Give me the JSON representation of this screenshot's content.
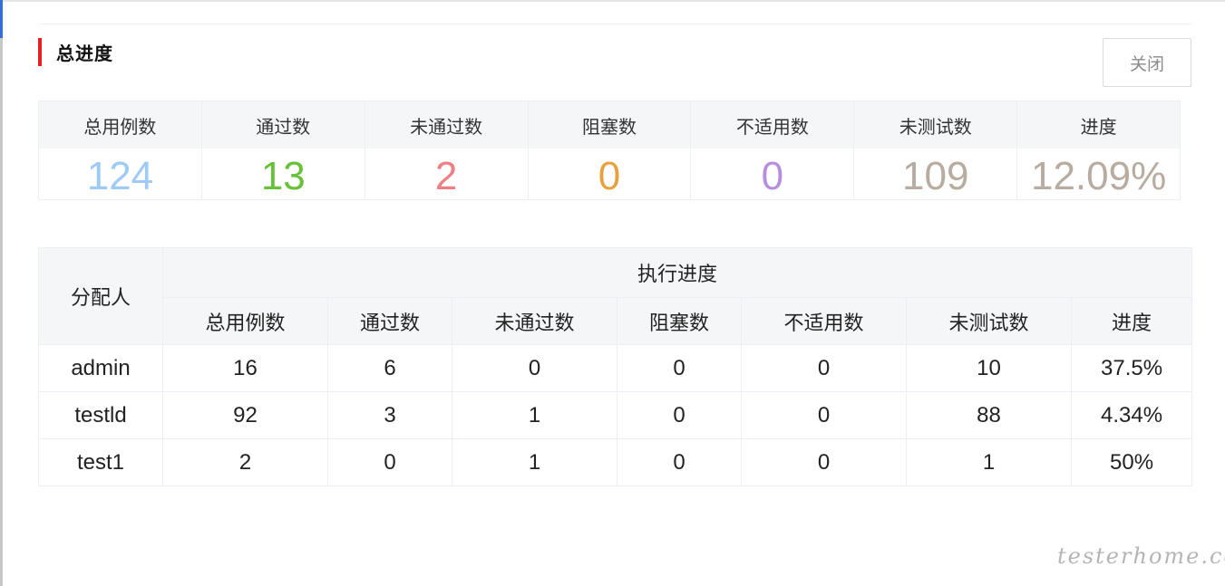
{
  "section": {
    "title": "总进度"
  },
  "close_button": {
    "label": "关闭"
  },
  "summary": [
    {
      "label": "总用例数",
      "value": "124",
      "color": "#9ecbf5"
    },
    {
      "label": "通过数",
      "value": "13",
      "color": "#67c23a"
    },
    {
      "label": "未通过数",
      "value": "2",
      "color": "#f07f83"
    },
    {
      "label": "阻塞数",
      "value": "0",
      "color": "#e6a23c"
    },
    {
      "label": "不适用数",
      "value": "0",
      "color": "#b68ee0"
    },
    {
      "label": "未测试数",
      "value": "109",
      "color": "#b8aca0"
    },
    {
      "label": "进度",
      "value": "12.09%",
      "color": "#b8aca0"
    }
  ],
  "table": {
    "assignee_header": "分配人",
    "group_header": "执行进度",
    "columns": [
      "总用例数",
      "通过数",
      "未通过数",
      "阻塞数",
      "不适用数",
      "未测试数",
      "进度"
    ],
    "rows": [
      {
        "assignee": "admin",
        "cells": [
          "16",
          "6",
          "0",
          "0",
          "0",
          "10",
          "37.5%"
        ]
      },
      {
        "assignee": "testld",
        "cells": [
          "92",
          "3",
          "1",
          "0",
          "0",
          "88",
          "4.34%"
        ]
      },
      {
        "assignee": "test1",
        "cells": [
          "2",
          "0",
          "1",
          "0",
          "0",
          "1",
          "50%"
        ]
      }
    ]
  },
  "watermark": "testerhome.com"
}
